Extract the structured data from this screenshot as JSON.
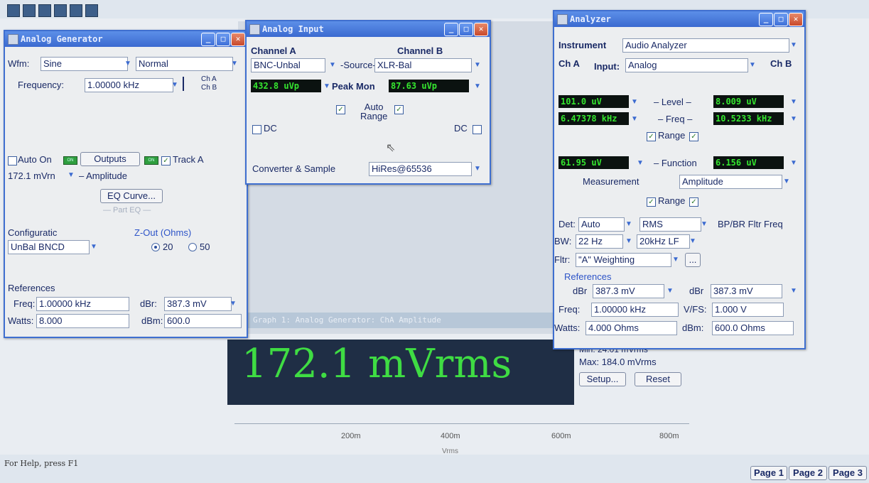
{
  "colors": {
    "title_bar": "#3b6ad0",
    "lcd_bg": "#0b1210",
    "lcd_text": "#35e62f",
    "meter_bg": "#1f2e45",
    "meter_text": "#3fdc43"
  },
  "generator": {
    "title": "Analog Generator",
    "wfm_label": "Wfm:",
    "wfm_value": "Sine",
    "wfm_mode": "Normal",
    "freq_label": "Frequency:",
    "freq_value": "1.00000 kHz",
    "cha": "Ch A",
    "chb": "Ch B",
    "auto_on": "Auto On",
    "outputs": "Outputs",
    "track_a": "Track A",
    "amplitude_value": "172.1 mVrn",
    "amplitude_label": "– Amplitude",
    "eq_curve": "EQ Curve...",
    "part_eq": "— Part EQ —",
    "config_label": "Configuratic",
    "config_value": "UnBal BNCD",
    "zout_label": "Z-Out (Ohms)",
    "z20": "20",
    "z50": "50",
    "references": "References",
    "ref_freq_label": "Freq:",
    "ref_freq": "1.00000 kHz",
    "ref_dbr_label": "dBr:",
    "ref_dbr": "387.3 mV",
    "ref_watts_label": "Watts:",
    "ref_watts": "8.000",
    "ref_dbm_label": "dBm:",
    "ref_dbm": "600.0"
  },
  "input": {
    "title": "Analog Input",
    "cha_label": "Channel A",
    "chb_label": "Channel B",
    "cha_value": "BNC-Unbal",
    "source_label": "-Source-",
    "chb_value": "XLR-Bal",
    "peak_a": "432.8 uVp",
    "peak_label": "Peak Mon",
    "peak_b": "87.63 uVp",
    "auto_range": "Auto\nRange",
    "dc": "DC",
    "converter_label": "Converter & Sample",
    "converter_value": "HiRes@65536"
  },
  "analyzer": {
    "title": "Analyzer",
    "instrument_label": "Instrument",
    "instrument_value": "Audio Analyzer",
    "cha": "Ch A",
    "input_label": "Input:",
    "input_value": "Analog",
    "chb": "Ch B",
    "level_a": "101.0 uV",
    "level_label": "– Level –",
    "level_b": "8.009 uV",
    "freq_a": "6.47378 kHz",
    "freq_label": "– Freq –",
    "freq_b": "10.5233 kHz",
    "range": "Range",
    "func_a": "61.95 uV",
    "func_label": "– Function",
    "func_b": "6.156 uV",
    "measurement_label": "Measurement",
    "measurement_value": "Amplitude",
    "det_label": "Det:",
    "det_value": "Auto",
    "det_mode": "RMS",
    "bpbr": "BP/BR Fltr Freq",
    "bw_label": "BW:",
    "bw_value": "22 Hz",
    "bw_hi": "20kHz LF",
    "fltr_label": "Fltr:",
    "fltr_value": "\"A\" Weighting",
    "more": "...",
    "references": "References",
    "ref_dbr_label": "dBr",
    "ref_dbr_a": "387.3 mV",
    "ref_dbr_b": "387.3 mV",
    "ref_freq_label": "Freq:",
    "ref_freq": "1.00000 kHz",
    "vfs_label": "V/FS:",
    "vfs_value": "1.000 V",
    "watts_label": "Watts:",
    "watts_value": "4.000 Ohms",
    "dbm_label": "dBm:",
    "dbm_value": "600.0 Ohms"
  },
  "meter": {
    "value": "172.1 mVrms",
    "graph_title": "Graph 1: Analog Generator: ChA Amplitude",
    "min": "Min: 24.01 mVrms",
    "max": "Max: 184.0 mVrms",
    "setup": "Setup...",
    "reset": "Reset",
    "ticks": [
      "200m",
      "400m",
      "600m",
      "800m"
    ],
    "axis": "Vrms"
  },
  "status": {
    "help": "For Help, press F1",
    "pages": [
      "Page 1",
      "Page 2",
      "Page 3"
    ]
  }
}
